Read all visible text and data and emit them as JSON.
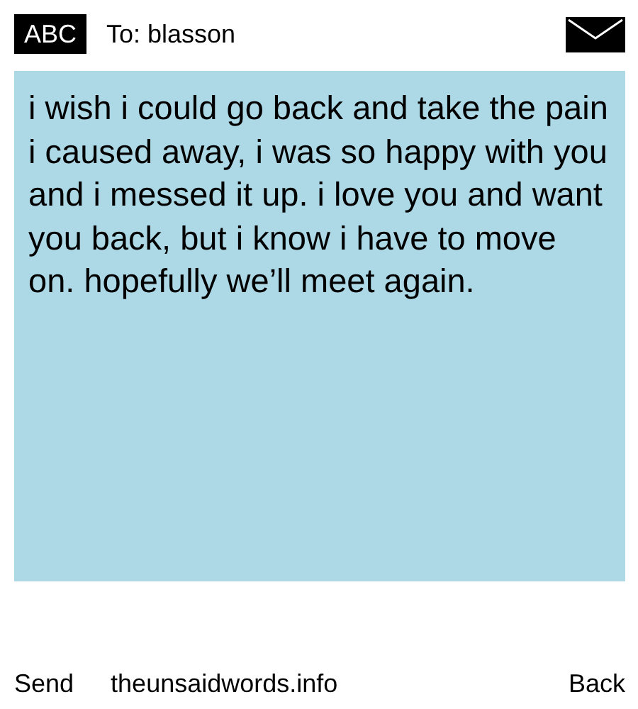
{
  "header": {
    "badge": "ABC",
    "recipient": "To: blasson"
  },
  "message": "i wish i could go back and take the pain i caused away, i was so happy with you and i messed it up. i love you and want you back, but i know i have to move on. hopefully we’ll meet again.",
  "footer": {
    "send": "Send",
    "site": "theunsaidwords.info",
    "back": "Back"
  }
}
